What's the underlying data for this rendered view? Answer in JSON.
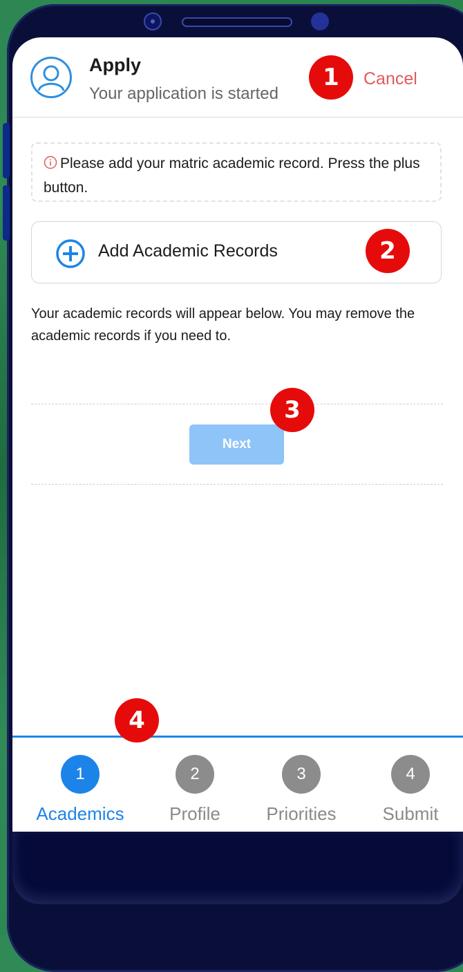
{
  "header": {
    "title": "Apply",
    "subtitle": "Your application is started",
    "cancel_label": "Cancel"
  },
  "notice": {
    "text": "Please add your matric academic record. Press the plus button."
  },
  "add_records": {
    "label": "Add Academic Records"
  },
  "help_text": "Your academic records will appear below. You may remove the academic records if you need to.",
  "next_label": "Next",
  "markers": [
    "1",
    "2",
    "3",
    "4"
  ],
  "steps": [
    {
      "number": "1",
      "label": "Academics",
      "state": "active"
    },
    {
      "number": "2",
      "label": "Profile",
      "state": "inactive"
    },
    {
      "number": "3",
      "label": "Priorities",
      "state": "inactive"
    },
    {
      "number": "4",
      "label": "Submit",
      "state": "inactive"
    }
  ],
  "colors": {
    "accent": "#1c84e8",
    "cancel": "#e05a5a",
    "marker": "#e60b0b",
    "next_button": "#8ec4f8",
    "inactive_step": "#8c8c8c"
  }
}
